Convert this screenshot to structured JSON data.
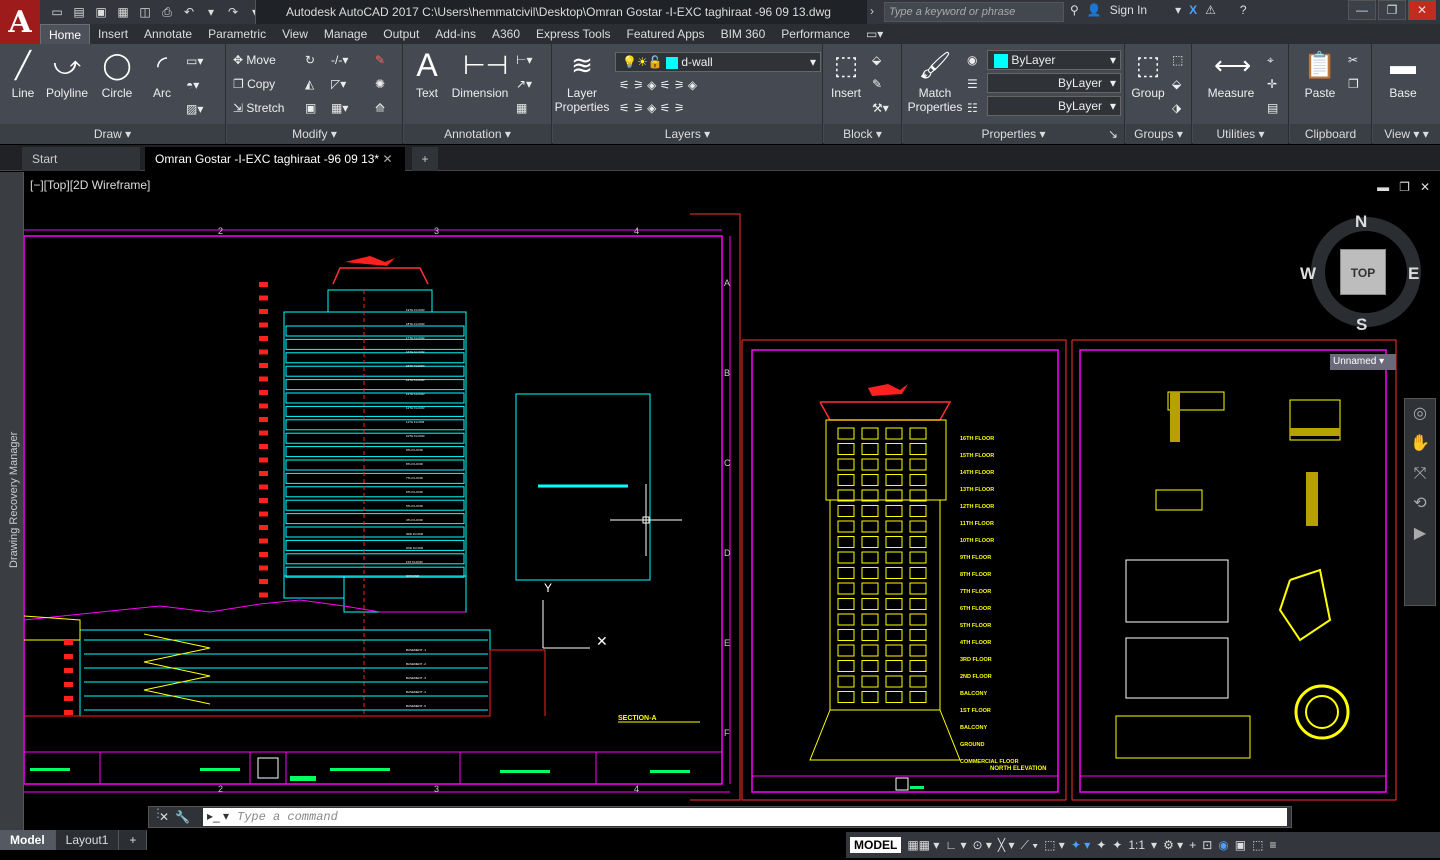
{
  "app": {
    "logo": "A",
    "title": "Autodesk AutoCAD 2017    C:\\Users\\hemmatcivil\\Desktop\\Omran Gostar -I-EXC   taghiraat -96 09 13.dwg",
    "search_placeholder": "Type a keyword or phrase",
    "sign_in": "Sign In"
  },
  "ribbon_tabs": [
    "Home",
    "Insert",
    "Annotate",
    "Parametric",
    "View",
    "Manage",
    "Output",
    "Add-ins",
    "A360",
    "Express Tools",
    "Featured Apps",
    "BIM 360",
    "Performance"
  ],
  "ribbon": {
    "draw": {
      "title": "Draw",
      "line": "Line",
      "polyline": "Polyline",
      "circle": "Circle",
      "arc": "Arc"
    },
    "modify": {
      "title": "Modify",
      "move": "Move",
      "copy": "Copy",
      "stretch": "Stretch"
    },
    "annotation": {
      "title": "Annotation",
      "text": "Text",
      "dimension": "Dimension"
    },
    "layers": {
      "title": "Layers",
      "layer_properties": "Layer\nProperties",
      "current_layer": "d-wall"
    },
    "block": {
      "title": "Block",
      "insert": "Insert"
    },
    "properties": {
      "title": "Properties",
      "match": "Match\nProperties",
      "color": "ByLayer",
      "linetype": "ByLayer",
      "lineweight": "ByLayer"
    },
    "groups": {
      "title": "Groups",
      "group": "Group"
    },
    "utilities": {
      "title": "Utilities",
      "measure": "Measure"
    },
    "clipboard": {
      "title": "Clipboard",
      "paste": "Paste"
    },
    "view": {
      "title": "View",
      "base": "Base"
    }
  },
  "doc_tabs": {
    "start": "Start",
    "active": "Omran Gostar -I-EXC   taghiraat -96 09 13*"
  },
  "side_palette": "Drawing Recovery Manager",
  "viewport": {
    "label": "[−][Top][2D Wireframe]",
    "compass": {
      "n": "N",
      "s": "S",
      "e": "E",
      "w": "W",
      "top": "TOP"
    },
    "ucs_name": "Unnamed",
    "sheet1": {
      "grid_cols": [
        "2",
        "3",
        "4"
      ],
      "grid_rows": [
        "A",
        "B",
        "C",
        "D",
        "E",
        "F"
      ],
      "section_label": "SECTION-A",
      "floor_labels": [
        "19TH FLOOR",
        "18TH FLOOR",
        "17TH FLOOR",
        "16TH FLOOR",
        "15TH FLOOR",
        "14TH FLOOR",
        "13TH FLOOR",
        "12TH FLOOR",
        "11TH FLOOR",
        "10TH FLOOR",
        "9TH FLOOR",
        "8TH FLOOR",
        "7TH FLOOR",
        "6TH FLOOR",
        "5TH FLOOR",
        "4TH FLOOR",
        "3RD FLOOR",
        "2ND FLOOR",
        "1ST FLOOR",
        "GROUND",
        "BASEMENT -1",
        "BASEMENT -2",
        "BASEMENT -3",
        "BASEMENT -4",
        "BASEMENT -5"
      ]
    },
    "sheet2": {
      "title": "NORTH ELEVATION",
      "floor_labels": [
        "16TH FLOOR",
        "15TH FLOOR",
        "14TH FLOOR",
        "13TH FLOOR",
        "12TH FLOOR",
        "11TH FLOOR",
        "10TH FLOOR",
        "9TH FLOOR",
        "8TH FLOOR",
        "7TH FLOOR",
        "6TH FLOOR",
        "5TH FLOOR",
        "4TH FLOOR",
        "3RD FLOOR",
        "2ND FLOOR",
        "BALCONY",
        "1ST FLOOR",
        "BALCONY",
        "GROUND",
        "COMMERCIAL FLOOR"
      ]
    }
  },
  "command_line": {
    "placeholder": "Type  a  command"
  },
  "layout_tabs": [
    "Model",
    "Layout1"
  ],
  "status": {
    "model": "MODEL",
    "scale": "1:1"
  },
  "colors": {
    "accent_red": "#9e1b1b",
    "magenta": "#ff00ff",
    "cyan": "#00ffff",
    "yellow": "#ffff00",
    "red": "#ff0000"
  }
}
